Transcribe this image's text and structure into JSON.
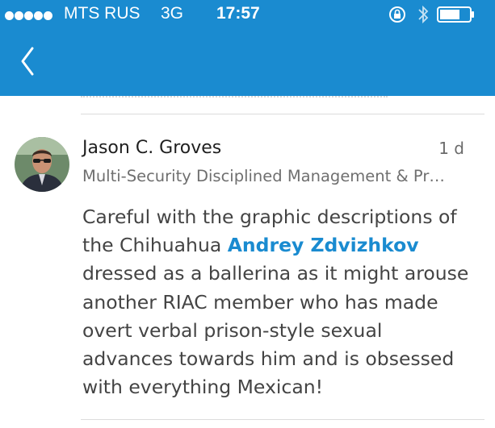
{
  "status_bar": {
    "carrier": "MTS RUS",
    "network": "3G",
    "time": "17:57",
    "icons": [
      "signal-dots-icon",
      "rotation-lock-icon",
      "bluetooth-icon",
      "battery-icon"
    ]
  },
  "nav": {
    "back_icon": "chevron-left-icon",
    "background_color": "#1a8bd0"
  },
  "comment": {
    "author_name": "Jason C. Groves",
    "timestamp": "1 d",
    "author_headline": "Multi-Security Disciplined Management & Pr…",
    "lines": [
      "Careful with the graphic descriptions of",
      "the Chihuahua",
      "dressed as a ballerina as it might arouse",
      "another RIAC member who has made",
      "overt verbal prison-style sexual",
      "advances towards him and is obsessed",
      "with everything Mexican!"
    ],
    "mention": "Andrey Zdvizhkov",
    "mention_color": "#1a8bd0"
  }
}
